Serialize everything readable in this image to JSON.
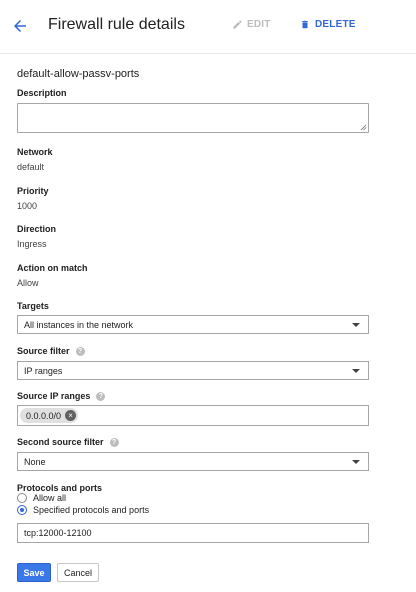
{
  "header": {
    "title": "Firewall rule details",
    "edit_label": "EDIT",
    "delete_label": "DELETE"
  },
  "rule": {
    "name": "default-allow-passv-ports"
  },
  "fields": {
    "description": {
      "label": "Description",
      "value": ""
    },
    "network": {
      "label": "Network",
      "value": "default"
    },
    "priority": {
      "label": "Priority",
      "value": "1000"
    },
    "direction": {
      "label": "Direction",
      "value": "Ingress"
    },
    "action": {
      "label": "Action on match",
      "value": "Allow"
    },
    "targets": {
      "label": "Targets",
      "value": "All instances in the network"
    },
    "source_filter": {
      "label": "Source filter",
      "value": "IP ranges"
    },
    "source_ip_ranges": {
      "label": "Source IP ranges",
      "chips": [
        "0.0.0.0/0"
      ]
    },
    "second_source_filter": {
      "label": "Second source filter",
      "value": "None"
    },
    "protocols": {
      "label": "Protocols and ports",
      "options": [
        "Allow all",
        "Specified protocols and ports"
      ],
      "selected": "Specified protocols and ports",
      "value": "tcp:12000-12100"
    }
  },
  "actions": {
    "save_label": "Save",
    "cancel_label": "Cancel"
  },
  "colors": {
    "accent": "#3367d6",
    "primary_button": "#3b78e7",
    "disabled": "#bdbdbd"
  },
  "icons": [
    "back-arrow-icon",
    "pencil-icon",
    "trash-icon",
    "help-icon",
    "dropdown-arrow-icon",
    "remove-chip-icon",
    "resize-handle-icon"
  ]
}
